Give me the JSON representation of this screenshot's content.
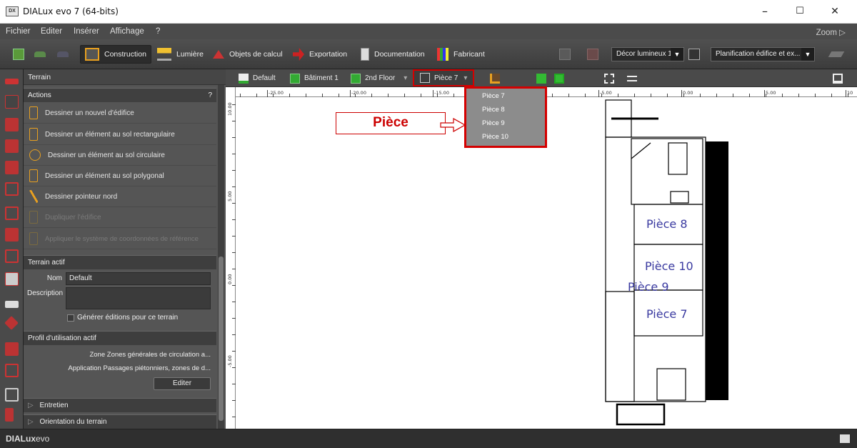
{
  "window": {
    "title": "DIALux evo 7  (64-bits)",
    "app_icon_text": "DX",
    "min": "–",
    "max": "☐",
    "close": "✕"
  },
  "menu": {
    "items": [
      "Fichier",
      "Editer",
      "Insérer",
      "Affichage",
      "?"
    ],
    "zoom": "Zoom ▷"
  },
  "toolbar": {
    "tabs": [
      "Construction",
      "Lumière",
      "Objets de calcul",
      "Exportation",
      "Documentation",
      "Fabricant"
    ],
    "active_tab": "Construction",
    "decor_select": "Décor lumineux 1",
    "planning_select": "Planification édifice et ex..."
  },
  "panel": {
    "header": "Terrain",
    "actions_title": "Actions",
    "actions_help": "?",
    "actions": [
      {
        "label": "Dessiner un nouvel d'édifice",
        "enabled": true
      },
      {
        "label": "Dessiner un élément au sol rectangulaire",
        "enabled": true
      },
      {
        "label": "Dessiner un élément au sol circulaire",
        "enabled": true
      },
      {
        "label": "Dessiner un élément au sol polygonal",
        "enabled": true
      },
      {
        "label": "Dessiner pointeur nord",
        "enabled": true
      },
      {
        "label": "Dupliquer l'édifice",
        "enabled": false
      },
      {
        "label": "Appliquer le système de coordonnées de référence",
        "enabled": false
      }
    ],
    "terrain_actif": {
      "title": "Terrain actif",
      "nom_label": "Nom",
      "nom_value": "Default",
      "description_label": "Description",
      "checkbox_label": "Générer éditions pour ce terrain"
    },
    "profil": {
      "title": "Profil d'utilisation actif",
      "zone_label": "Zone",
      "zone_value": "Zones générales de circulation a...",
      "application_label": "Application",
      "application_value": "Passages piétonniers, zones de d...",
      "edit_button": "Editer"
    },
    "collapsed_sections": [
      "Entretien",
      "Orientation du terrain"
    ]
  },
  "viewport_toolbar": {
    "terrain": "Default",
    "building": "Bâtiment 1",
    "floor": "2nd Floor",
    "room": "Pièce 7"
  },
  "room_dropdown": {
    "options": [
      "Pièce 7",
      "Pièce 8",
      "Pièce 9",
      "Pièce 10"
    ]
  },
  "callout": {
    "text": "Pièce"
  },
  "ruler": {
    "top_labels": [
      "-25.00",
      "-20.00",
      "-15.00",
      "-10.00",
      "-5.00",
      "0.00",
      "5.00",
      "10"
    ],
    "left_labels": [
      "10.00",
      "5.00",
      "0.00",
      "-5.00"
    ]
  },
  "floorplan": {
    "rooms": [
      "Pièce 8",
      "Pièce 10",
      "Pièce 9",
      "Pièce 7"
    ]
  },
  "statusbar": {
    "brand_bold": "DIALux",
    "brand_light": "evo"
  },
  "colors": {
    "accent_red": "#d40000",
    "room_label_blue": "#3a3aa0",
    "panel_bg": "#555555"
  }
}
